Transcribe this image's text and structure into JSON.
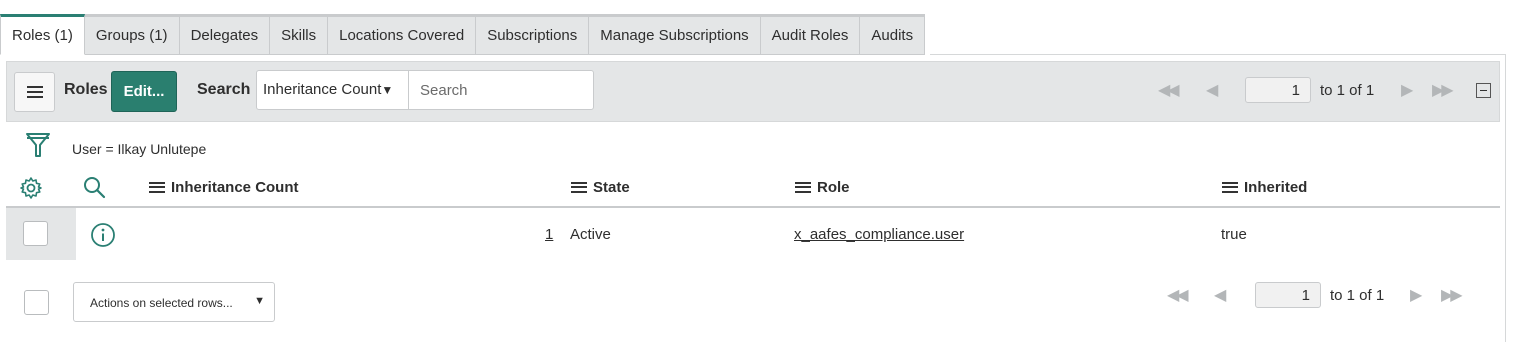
{
  "tabs": [
    {
      "label": "Roles (1)",
      "active": true
    },
    {
      "label": "Groups (1)"
    },
    {
      "label": "Delegates"
    },
    {
      "label": "Skills"
    },
    {
      "label": "Locations Covered"
    },
    {
      "label": "Subscriptions"
    },
    {
      "label": "Manage Subscriptions"
    },
    {
      "label": "Audit Roles"
    },
    {
      "label": "Audits"
    }
  ],
  "toolbar": {
    "title": "Roles",
    "edit_label": "Edit...",
    "search_label": "Search",
    "search_field": "Inheritance Count",
    "search_placeholder": "Search",
    "page": "1",
    "page_text": "to 1 of 1"
  },
  "filter": {
    "text": "User = Ilkay Unlutepe"
  },
  "columns": [
    "Inheritance Count",
    "State",
    "Role",
    "Inherited"
  ],
  "rows": [
    {
      "inheritance_count": "1",
      "state": "Active",
      "role": "x_aafes_compliance.user",
      "inherited": "true"
    }
  ],
  "footer": {
    "actions_label": "Actions on selected rows...",
    "page": "1",
    "page_text": "to 1 of 1"
  },
  "colors": {
    "accent": "#2a7f73",
    "toolbar_bg": "#e4e6e7"
  },
  "icons": [
    "hamburger-icon",
    "first-page-icon",
    "prev-page-icon",
    "next-page-icon",
    "last-page-icon",
    "collapse-icon",
    "filter-icon",
    "gear-icon",
    "search-icon",
    "info-icon",
    "caret-down-icon"
  ]
}
